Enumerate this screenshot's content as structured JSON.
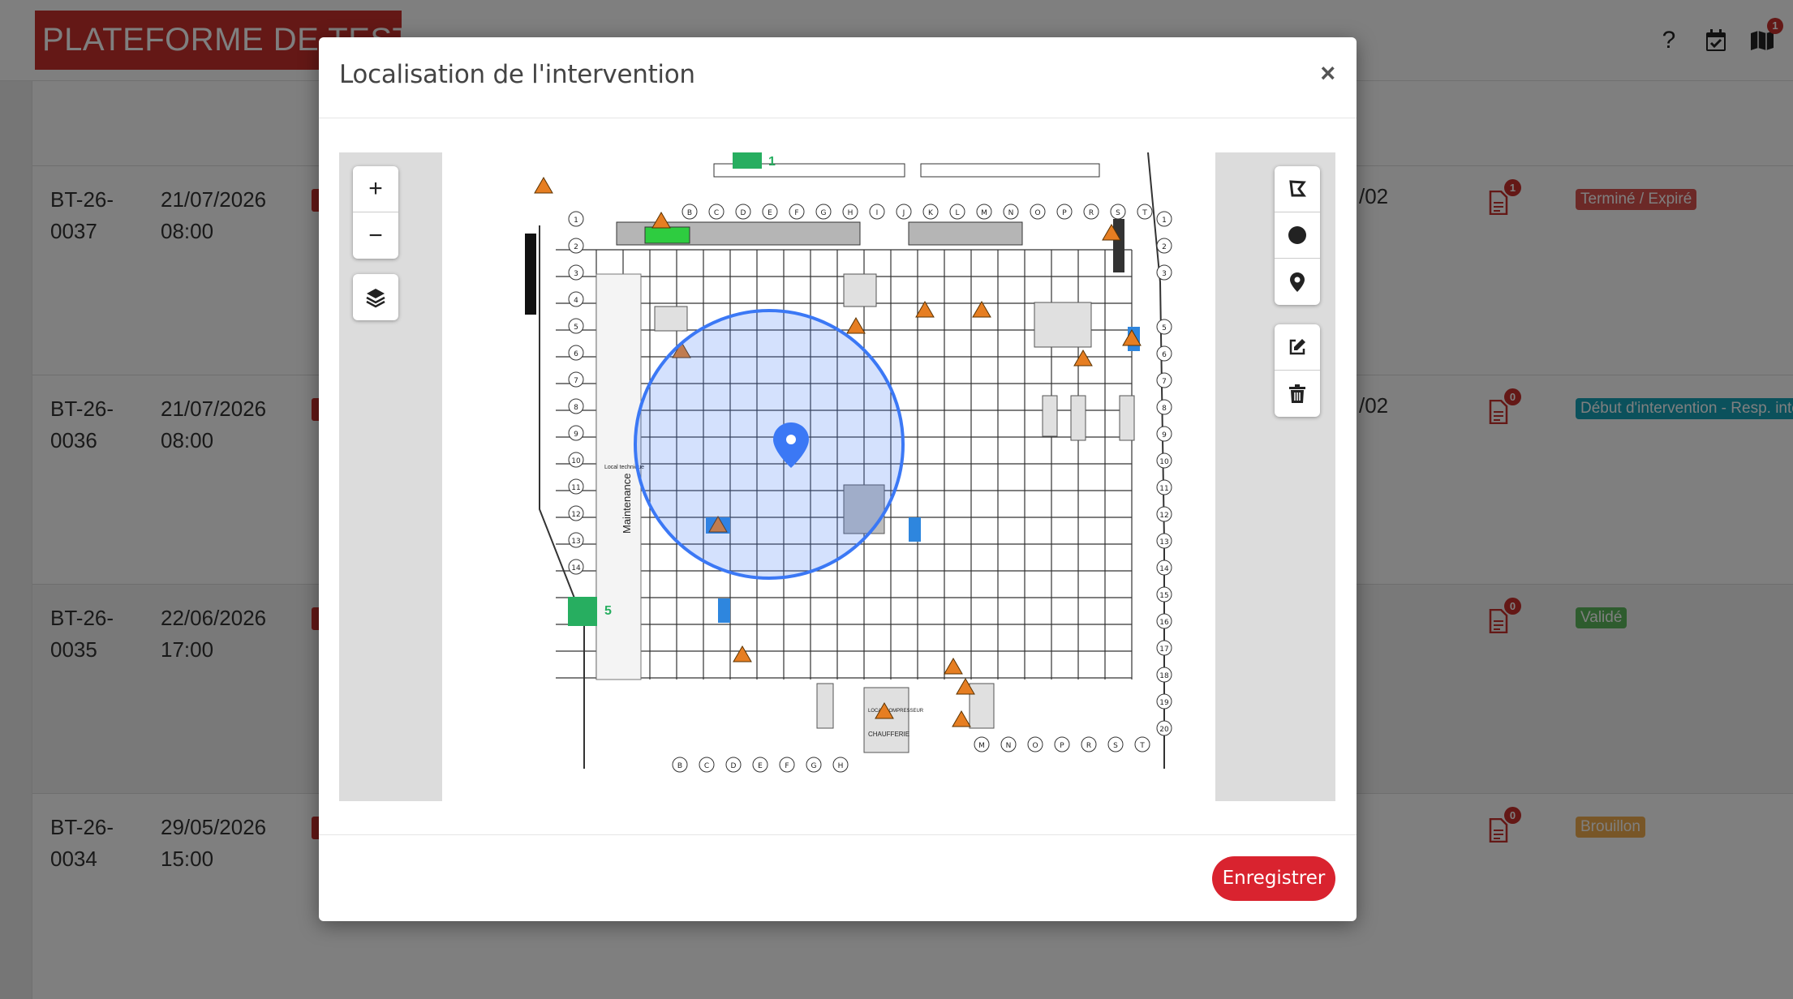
{
  "app": {
    "logo_text": "PLATEFORME DE TESTS",
    "help_label": "?",
    "map_badge": "1"
  },
  "rows": [
    {
      "ref": "BT-26-0037",
      "date": "21/07/2026 08:00",
      "suffix": "/02",
      "doc_count": "1",
      "status": "Terminé / Expiré",
      "status_color": "#d9534f"
    },
    {
      "ref": "BT-26-0036",
      "date": "21/07/2026 08:00",
      "suffix": "/02",
      "doc_count": "0",
      "status": "Début d'intervention - Resp. interv",
      "status_color": "#17a2b8"
    },
    {
      "ref": "BT-26-0035",
      "date": "22/06/2026 17:00",
      "suffix": "",
      "doc_count": "0",
      "status": "Validé",
      "status_color": "#5cb85c"
    },
    {
      "ref": "BT-26-0034",
      "date": "29/05/2026 15:00",
      "suffix": "",
      "doc_count": "0",
      "status": "Brouillon",
      "status_color": "#f0ad4e"
    }
  ],
  "modal": {
    "title": "Localisation de l'intervention",
    "close_label": "×",
    "save_label": "Enregistrer"
  },
  "map": {
    "zoom_in_label": "+",
    "zoom_out_label": "−",
    "layers_icon": "layers-icon",
    "draw_tools": [
      "polygon-icon",
      "circle-icon",
      "marker-icon"
    ],
    "edit_tools": [
      "edit-icon",
      "trash-icon"
    ],
    "plan_labels": {
      "maintenance": "Maintenance",
      "local_technique": "Local technique",
      "chaufferie": "CHAUFFERIE",
      "local_compresseur": "LOCAL COMPRESSEUR",
      "aid_left": "5",
      "aid_top": "1"
    }
  }
}
